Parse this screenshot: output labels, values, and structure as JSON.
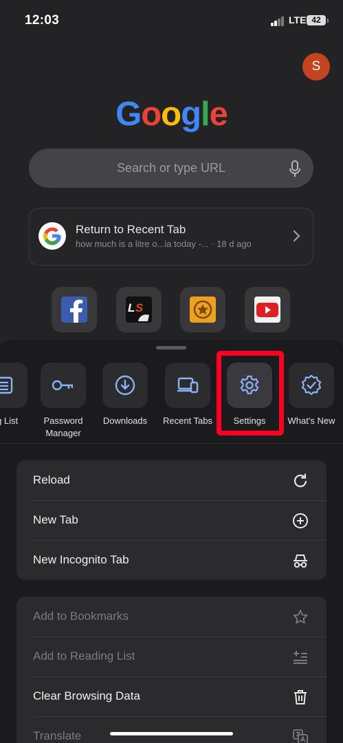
{
  "status_bar": {
    "time": "12:03",
    "network": "LTE",
    "battery": "42"
  },
  "profile": {
    "initial": "S",
    "color": "#c5431f"
  },
  "logo": {
    "letters": [
      "G",
      "o",
      "o",
      "g",
      "l",
      "e"
    ],
    "colors": [
      "#4285f4",
      "#ea4335",
      "#fbbc05",
      "#4285f4",
      "#34a853",
      "#ea4335"
    ]
  },
  "search": {
    "placeholder": "Search or type URL"
  },
  "recent_tab": {
    "title": "Return to Recent Tab",
    "subtitle": "how much is a litre o...ia today -... · 18 d ago"
  },
  "shortcuts": [
    {
      "name": "facebook"
    },
    {
      "name": "ls"
    },
    {
      "name": "star"
    },
    {
      "name": "youtube"
    }
  ],
  "actions": [
    {
      "label": "ng List",
      "icon": "reading-list-icon"
    },
    {
      "label": "Password Manager",
      "icon": "key-icon"
    },
    {
      "label": "Downloads",
      "icon": "download-icon"
    },
    {
      "label": "Recent Tabs",
      "icon": "devices-icon"
    },
    {
      "label": "Settings",
      "icon": "gear-icon"
    },
    {
      "label": "What's New",
      "icon": "badge-check-icon"
    }
  ],
  "menu_group_1": [
    {
      "label": "Reload",
      "icon": "reload-icon"
    },
    {
      "label": "New Tab",
      "icon": "plus-circle-icon"
    },
    {
      "label": "New Incognito Tab",
      "icon": "incognito-icon"
    }
  ],
  "menu_group_2": [
    {
      "label": "Add to Bookmarks",
      "icon": "star-icon"
    },
    {
      "label": "Add to Reading List",
      "icon": "add-reading-list-icon"
    },
    {
      "label": "Clear Browsing Data",
      "icon": "trash-icon"
    },
    {
      "label": "Translate",
      "icon": "translate-icon"
    }
  ],
  "colors": {
    "accent": "#8ab4f8",
    "highlight": "#ff0022"
  }
}
